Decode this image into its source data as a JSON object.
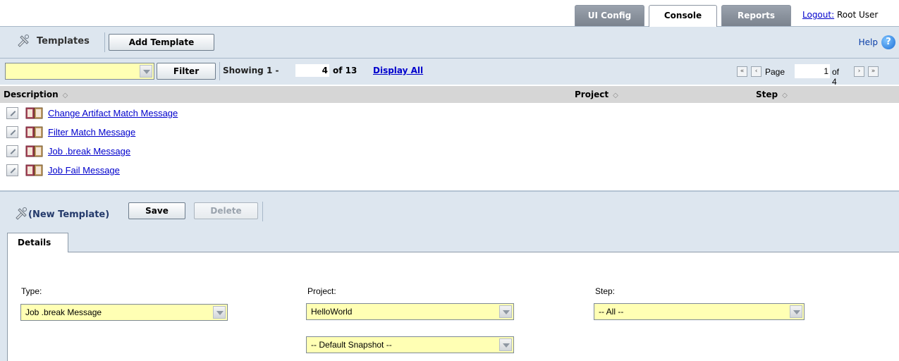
{
  "tabs": [
    {
      "label": "UI Config",
      "active": false
    },
    {
      "label": "Console",
      "active": true
    },
    {
      "label": "Reports",
      "active": false
    }
  ],
  "user": {
    "logout_label": "Logout:",
    "name": "Root User"
  },
  "toolbar": {
    "title": "Templates",
    "add_label": "Add Template",
    "help_label": "Help",
    "help_glyph": "?"
  },
  "filter": {
    "value": "",
    "button_label": "Filter",
    "showing_prefix": "Showing 1 -",
    "showing_count": "4",
    "showing_total": "of 13",
    "display_all": "Display All"
  },
  "pager": {
    "page_label": "Page",
    "current": "1",
    "of_total": "of 4"
  },
  "table": {
    "columns": [
      "Description",
      "Project",
      "Step"
    ],
    "rows": [
      {
        "description": "Change Artifact Match Message",
        "project": "",
        "step": ""
      },
      {
        "description": "Filter Match Message",
        "project": "",
        "step": ""
      },
      {
        "description": "Job .break Message",
        "project": "",
        "step": ""
      },
      {
        "description": "Job Fail Message",
        "project": "",
        "step": ""
      }
    ]
  },
  "editor": {
    "title": "(New Template)",
    "save_label": "Save",
    "delete_label": "Delete",
    "tab_label": "Details",
    "type_label": "Type:",
    "type_value": "Job .break Message",
    "project_label": "Project:",
    "project_value": "HelloWorld",
    "snapshot_value": "-- Default Snapshot --",
    "step_label": "Step:",
    "step_value": "-- All --"
  },
  "colors": {
    "input_bg": "#ffffb4",
    "toolbar_bg": "#dde6ef",
    "link": "#0000cc"
  }
}
